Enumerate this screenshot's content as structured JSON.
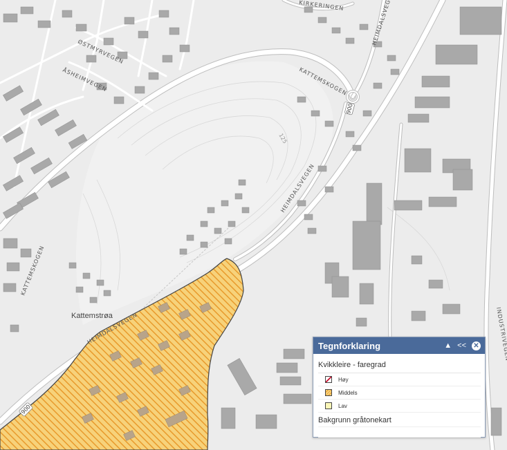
{
  "map": {
    "road_labels": {
      "kirkeringen": "KIRKERINGEN",
      "heimdalsvegen_ne": "HEIMDALSVEGEN",
      "ostmyrvegen": "ØSTMYRVEGEN",
      "asheimvegen": "ÅSHEIMVEGEN",
      "kattemskogen_n": "KATTEMSKOGEN",
      "heimdalsvegen_mid": "HEIMDALSVEGEN",
      "kattemskogen_w": "KATTEMSKOGEN",
      "heimdalsvegen_s": "HEIMDALSVEGEN",
      "industrivegen": "INDUSTRIVEGEN"
    },
    "place_labels": {
      "kattemstroa": "Kattemstrøa"
    },
    "route_numbers": {
      "north": "900",
      "southwest": "900"
    },
    "contour_labels": {
      "c125": "125"
    },
    "colors": {
      "background": "#ececec",
      "building": "#a9a9a9",
      "road": "#ffffff",
      "hazard_fill": "#f7d27a",
      "hazard_hatch": "#e89a2c"
    }
  },
  "legend": {
    "title": "Tegnforklaring",
    "buttons": {
      "collapse": "▲",
      "back": "<<",
      "close": "✕"
    },
    "layer_title": "Kvikkleire - faregrad",
    "items": [
      {
        "label": "Høy",
        "color": "#c8102e"
      },
      {
        "label": "Middels",
        "color": "#e89a2c"
      },
      {
        "label": "Lav",
        "color": "#fbf7b8"
      }
    ],
    "layer2_title": "Bakgrunn gråtonekart"
  }
}
